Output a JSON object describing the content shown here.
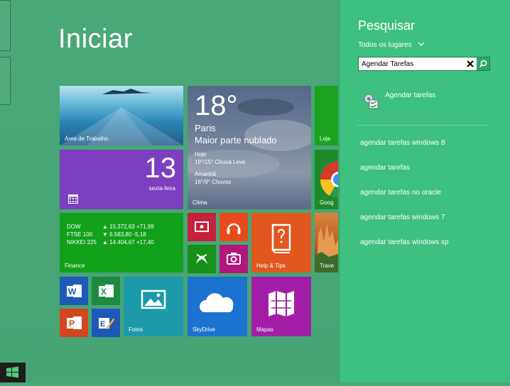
{
  "start": {
    "title": "Iniciar"
  },
  "tiles": {
    "desktop_label": "Área de Trabalho",
    "calendar_day": "13",
    "calendar_weekday": "sexta-feira",
    "weather": {
      "temp": "18°",
      "city": "Paris",
      "condition": "Maior parte nublado",
      "today_label": "Hoje",
      "today_value": "19°/15° Chuva Leve",
      "tomorrow_label": "Amanhã",
      "tomorrow_value": "16°/9° Chuvas",
      "label": "Clima"
    },
    "store_label": "Loja",
    "chrome_label": "Goog",
    "finance": {
      "rows": [
        {
          "name": "DOW",
          "value": "▲ 15.372,63 +71,99"
        },
        {
          "name": "FTSE 100",
          "value": "▼ 6.583,80 -5,18"
        },
        {
          "name": "NIKKEI 225",
          "value": "▲ 14.404,67 +17,40"
        }
      ],
      "label": "Finance"
    },
    "help_label": "Help & Tips",
    "travel_label": "Trave",
    "photos_label": "Fotos",
    "skydrive_label": "SkyDrive",
    "maps_label": "Mapas"
  },
  "search": {
    "title": "Pesquisar",
    "scope": "Todos os lugares",
    "query": "Agendar Tarefas",
    "app_result": "Agendar tarefas",
    "suggestions": [
      "agendar tarefas windows 8",
      "agendar tarefas",
      "agendar tarefas no oracle",
      "agendar tarefas windows 7",
      "agendar tarefas windows xp"
    ]
  },
  "colors": {
    "start_bg": "#4aa777",
    "pane_bg": "#3ec080",
    "calendar": "#7b3fbf",
    "finance": "#12a11b",
    "help": "#e2561f",
    "photos": "#1c9aa9",
    "skydrive": "#1c73cf",
    "maps": "#a21ea6",
    "video": "#c4213b",
    "music": "#e84a1b",
    "games": "#17911b",
    "camera": "#b3157f"
  }
}
